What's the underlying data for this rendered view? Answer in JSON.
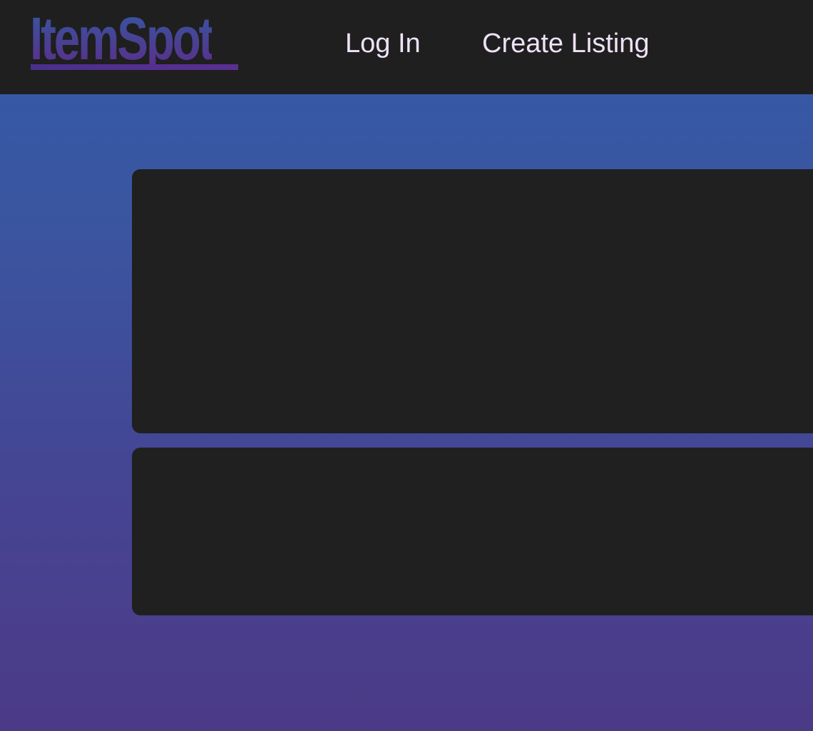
{
  "header": {
    "logo_text": "ItemSpot",
    "nav": {
      "login_label": "Log In",
      "create_listing_label": "Create Listing"
    }
  },
  "colors": {
    "header_background": "#1f1f1f",
    "nav_text": "#eee2f7",
    "logo_gradient_top": "#3656a4",
    "logo_gradient_bottom": "#5a2f8f",
    "main_gradient_top": "#3658a5",
    "main_gradient_bottom": "#4b3a86",
    "card_background": "#202020"
  }
}
